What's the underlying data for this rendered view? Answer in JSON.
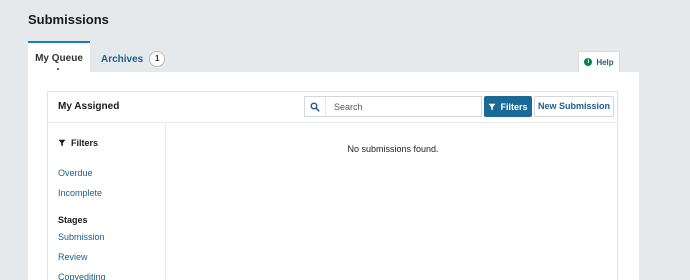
{
  "page": {
    "title": "Submissions"
  },
  "tabs": {
    "my_queue": {
      "label": "My Queue"
    },
    "archives": {
      "label": "Archives",
      "count": "1"
    }
  },
  "help": {
    "label": "Help"
  },
  "list": {
    "title": "My Assigned",
    "search": {
      "placeholder": "Search",
      "value": ""
    },
    "filters_button": "Filters",
    "new_submission_button": "New Submission",
    "empty_message": "No submissions found."
  },
  "sidebar": {
    "heading": "Filters",
    "quick_filters": [
      {
        "label": "Overdue"
      },
      {
        "label": "Incomplete"
      }
    ],
    "stages_heading": "Stages",
    "stages": [
      {
        "label": "Submission"
      },
      {
        "label": "Review"
      },
      {
        "label": "Copyediting"
      }
    ]
  },
  "colors": {
    "accent": "#1b6a96",
    "link": "#1d5f8a",
    "tab_active_border": "#1a7cc1",
    "help_icon": "#00854a",
    "background": "#e5e9ec"
  },
  "icons": {
    "search": "search-icon",
    "filter": "filter-icon",
    "help": "help-icon"
  }
}
